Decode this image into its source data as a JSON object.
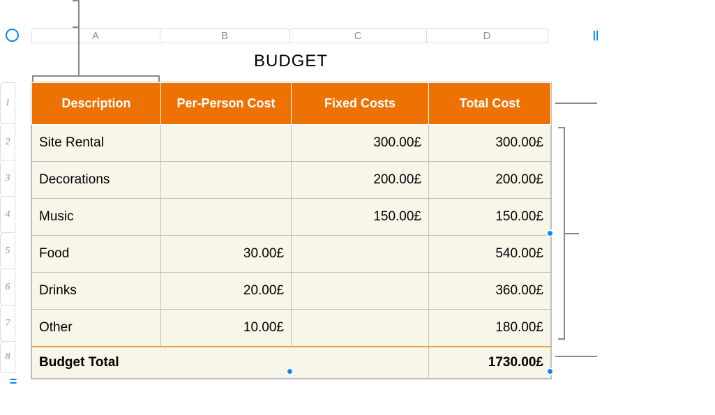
{
  "title": "BUDGET",
  "column_letters": [
    "A",
    "B",
    "C",
    "D"
  ],
  "row_numbers": [
    "1",
    "2",
    "3",
    "4",
    "5",
    "6",
    "7",
    "8"
  ],
  "headers": {
    "description": "Description",
    "per_person": "Per-Person Cost",
    "fixed": "Fixed Costs",
    "total": "Total Cost"
  },
  "rows": [
    {
      "desc": "Site Rental",
      "per_person": "",
      "fixed": "300.00£",
      "total": "300.00£"
    },
    {
      "desc": "Decorations",
      "per_person": "",
      "fixed": "200.00£",
      "total": "200.00£"
    },
    {
      "desc": "Music",
      "per_person": "",
      "fixed": "150.00£",
      "total": "150.00£"
    },
    {
      "desc": "Food",
      "per_person": "30.00£",
      "fixed": "",
      "total": "540.00£"
    },
    {
      "desc": "Drinks",
      "per_person": "20.00£",
      "fixed": "",
      "total": "360.00£"
    },
    {
      "desc": "Other",
      "per_person": "10.00£",
      "fixed": "",
      "total": "180.00£"
    }
  ],
  "footer": {
    "label": "Budget Total",
    "total": "1730.00£"
  },
  "icons": {
    "add_columns": "||",
    "equals": "="
  }
}
